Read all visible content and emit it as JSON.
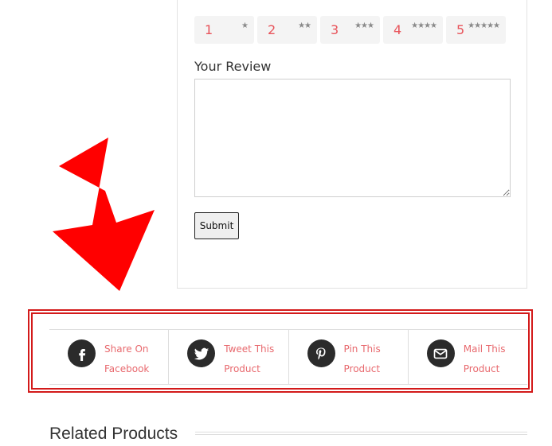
{
  "review": {
    "ratings": [
      {
        "number": "1",
        "stars": "★"
      },
      {
        "number": "2",
        "stars": "★★"
      },
      {
        "number": "3",
        "stars": "★★★"
      },
      {
        "number": "4",
        "stars": "★★★★"
      },
      {
        "number": "5",
        "stars": "★★★★★"
      }
    ],
    "label": "Your Review",
    "textarea_value": "",
    "submit_label": "Submit"
  },
  "share": {
    "items": [
      {
        "line1": "Share On",
        "line2": "Facebook",
        "icon": "facebook-icon"
      },
      {
        "line1": "Tweet This",
        "line2": "Product",
        "icon": "twitter-icon"
      },
      {
        "line1": "Pin This",
        "line2": "Product",
        "icon": "pinterest-icon"
      },
      {
        "line1": "Mail This",
        "line2": "Product",
        "icon": "mail-icon"
      }
    ]
  },
  "related": {
    "title": "Related Products"
  },
  "colors": {
    "accent": "#e8535a",
    "annotation_red": "#ff0000",
    "icon_bg": "#2b2b2b"
  }
}
